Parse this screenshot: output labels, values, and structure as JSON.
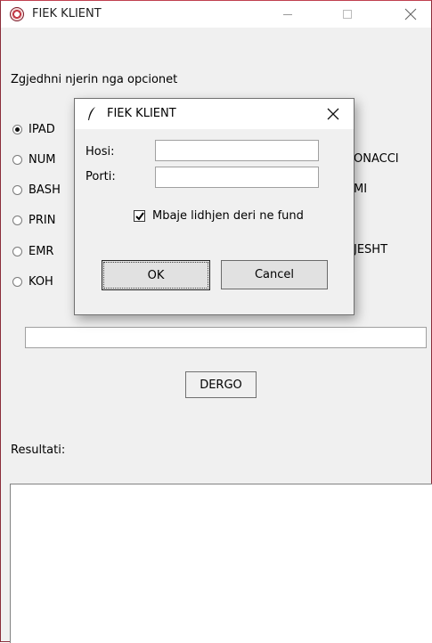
{
  "window": {
    "title": "FIEK KLIENT",
    "controls": {
      "minimize": "—",
      "close": "✕"
    }
  },
  "main": {
    "prompt": "Zgjedhni njerin nga opcionet",
    "options": [
      {
        "label": "IPAD",
        "checked": true
      },
      {
        "label": "NUM",
        "checked": false
      },
      {
        "label": "BASH",
        "checked": false
      },
      {
        "label": "PRIN",
        "checked": false
      },
      {
        "label": "EMR",
        "checked": false
      },
      {
        "label": "KOH",
        "checked": false
      }
    ],
    "right_options": [
      "ONACCI",
      "MI",
      "JESHT"
    ],
    "input_value": "",
    "send_label": "DERGO",
    "result_label": "Resultati:",
    "result_value": ""
  },
  "dialog": {
    "title": "FIEK KLIENT",
    "close": "✕",
    "host_label": "Hosi:",
    "host_value": "",
    "port_label": "Porti:",
    "port_value": "",
    "keep_connection_label": "Mbaje lidhjen deri ne fund",
    "keep_connection_checked": true,
    "ok_label": "OK",
    "cancel_label": "Cancel"
  }
}
